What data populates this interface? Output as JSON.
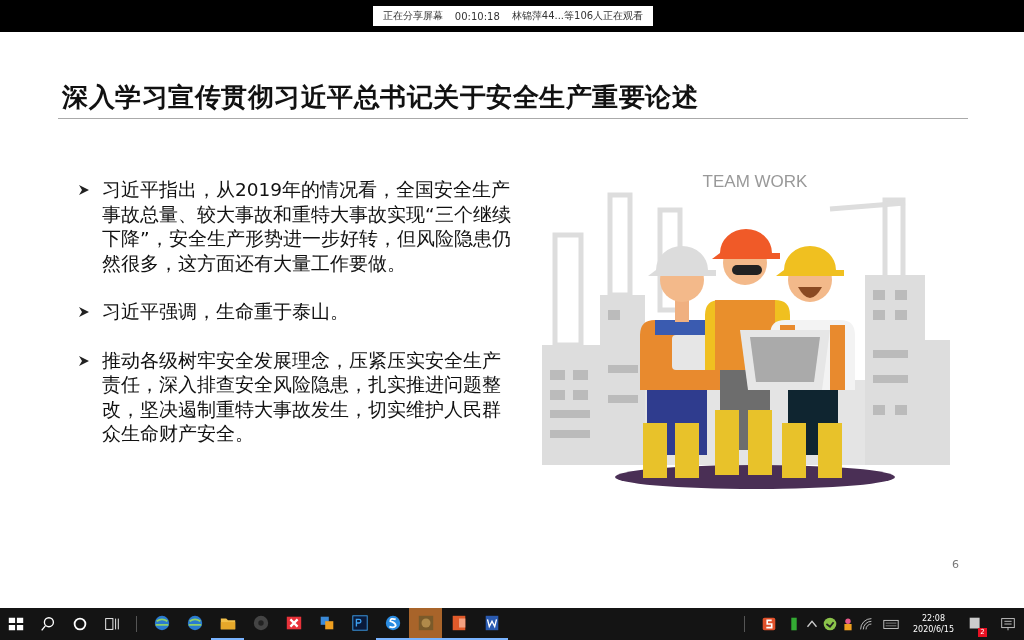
{
  "share_bar": {
    "status": "正在分享屏幕",
    "timer": "00:10:18",
    "viewers": "林锦萍44...等106人正在观看"
  },
  "slide": {
    "title": "深入学习宣传贯彻习近平总书记关于安全生产重要论述",
    "bullets": [
      "习近平指出，从2019年的情况看，全国安全生产事故总量、较大事故和重特大事故实现“三个继续下降”，安全生产形势进一步好转，但风险隐患仍然很多，这方面还有大量工作要做。",
      "习近平强调，生命重于泰山。",
      "推动各级树牢安全发展理念，压紧压实安全生产责任，深入排查安全风险隐患，扎实推进问题整改，坚决遏制重特大事故发生，切实维护人民群众生命财产安全。"
    ],
    "illustration_caption": "TEAM WORK",
    "page_number": "6"
  },
  "taskbar": {
    "apps": [
      {
        "kind": "globe",
        "running": false,
        "selected": false
      },
      {
        "kind": "globe",
        "running": false,
        "selected": false
      },
      {
        "kind": "folder",
        "running": true,
        "selected": false
      },
      {
        "kind": "disc",
        "running": false,
        "selected": false
      },
      {
        "kind": "xmark",
        "running": false,
        "selected": false
      },
      {
        "kind": "stack",
        "running": false,
        "selected": false
      },
      {
        "kind": "ps",
        "running": false,
        "selected": false
      },
      {
        "kind": "sphere",
        "running": true,
        "selected": false
      },
      {
        "kind": "photo",
        "running": true,
        "selected": true
      },
      {
        "kind": "ppt",
        "running": true,
        "selected": false
      },
      {
        "kind": "word",
        "running": true,
        "selected": false
      }
    ],
    "time": "22:08",
    "date": "2020/6/15",
    "notification_count": "2"
  }
}
